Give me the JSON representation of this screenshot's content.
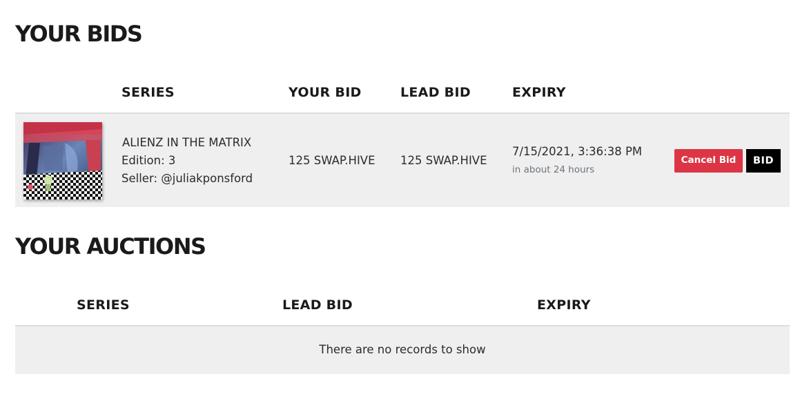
{
  "bids_section": {
    "title": "YOUR BIDS",
    "columns": {
      "series": "SERIES",
      "your_bid": "YOUR BID",
      "lead_bid": "LEAD BID",
      "expiry": "EXPIRY"
    },
    "rows": [
      {
        "thumbnail_icon": "nft-artwork-thumbnail",
        "series_name": "ALIENZ IN THE MATRIX",
        "edition": "Edition: 3",
        "seller": "Seller: @juliakponsford",
        "your_bid": "125 SWAP.HIVE",
        "lead_bid": "125 SWAP.HIVE",
        "expiry_date": "7/15/2021, 3:36:38 PM",
        "expiry_relative": "in about 24 hours",
        "cancel_label": "Cancel Bid",
        "bid_label": "BID"
      }
    ]
  },
  "auctions_section": {
    "title": "YOUR AUCTIONS",
    "columns": {
      "series": "SERIES",
      "lead_bid": "LEAD BID",
      "expiry": "EXPIRY"
    },
    "empty_message": "There are no records to show"
  },
  "colors": {
    "cancel_button": "#dc3545",
    "bid_button": "#000000",
    "row_background": "#efefef",
    "divider": "#dcdcdc"
  }
}
